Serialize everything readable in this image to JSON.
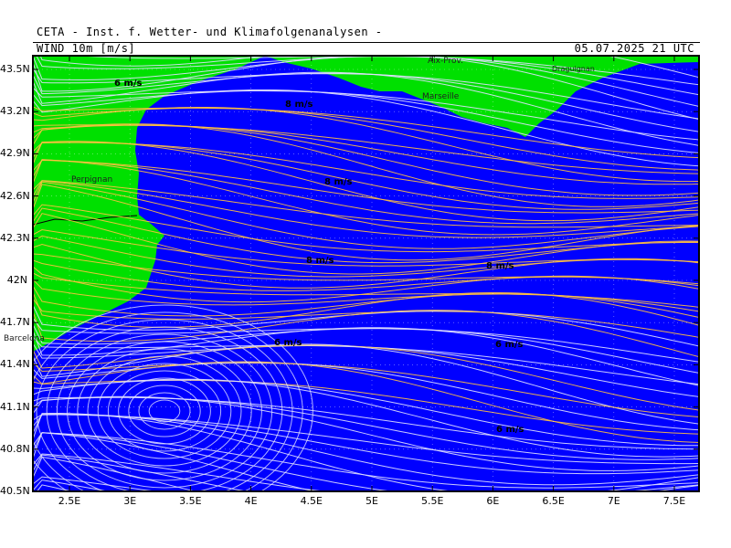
{
  "header": {
    "institute": "CETA - Inst. f. Wetter- und Klimafolgenanalysen -",
    "product": "WIND 10m [m/s]",
    "valid_time": "05.07.2025 21 UTC"
  },
  "axes": {
    "y_ticks": [
      "43.5N",
      "43.2N",
      "42.9N",
      "42.6N",
      "42.3N",
      "42N",
      "41.7N",
      "41.4N",
      "41.1N",
      "40.8N",
      "40.5N"
    ],
    "x_ticks": [
      "2.5E",
      "3E",
      "3.5E",
      "4E",
      "4.5E",
      "5E",
      "5.5E",
      "6E",
      "6.5E",
      "7E",
      "7.5E"
    ]
  },
  "places": {
    "perpignan": "Perpignan",
    "barcelona": "Barcelona",
    "marseille": "Marseille",
    "aix": "Aix-Prov.",
    "draguignan": "Draguignan"
  },
  "speed_labels": {
    "l1": "6 m/s",
    "l2": "8 m/s",
    "l3": "8 m/s",
    "l4": "8 m/s",
    "l5": "8 m/s",
    "l6": "6 m/s",
    "l7": "6 m/s",
    "l8": "6 m/s"
  },
  "colors": {
    "sea": "#0000ff",
    "land": "#00e000",
    "stream_light": "#e0e0ff",
    "stream_strong": "#ffc040"
  }
}
